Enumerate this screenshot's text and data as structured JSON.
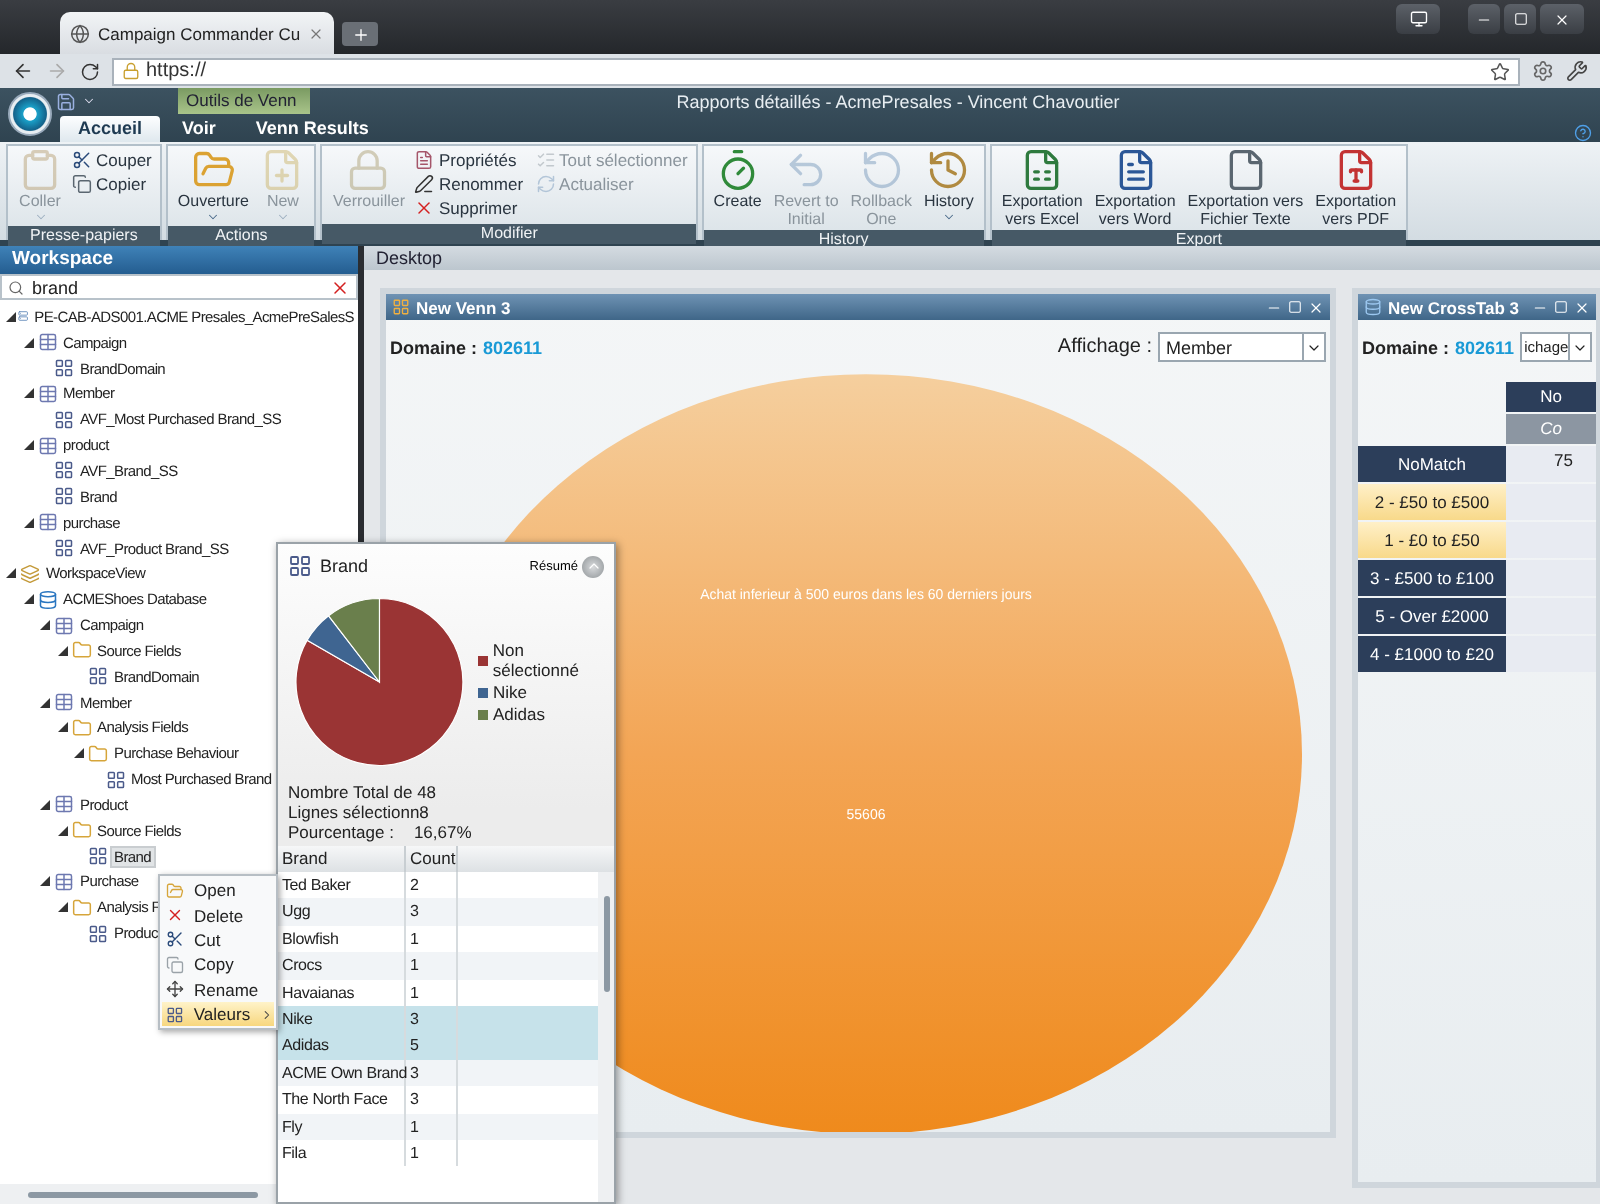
{
  "browser": {
    "tab_title": "Campaign Commander Cu",
    "address": "https://"
  },
  "app": {
    "context_tab": "Outils de Venn",
    "title": "Rapports détaillés - AcmePresales - Vincent Chavoutier"
  },
  "ribbon_tabs": [
    {
      "label": "Accueil",
      "selected": true
    },
    {
      "label": "Voir",
      "selected": false
    },
    {
      "label": "Venn Results",
      "selected": false
    }
  ],
  "ribbon_groups": [
    {
      "title": "Presse-papiers",
      "items": [
        {
          "label": "Coller",
          "kind": "large",
          "disabled": true,
          "dropdown": true
        },
        {
          "label": "Couper",
          "kind": "small",
          "disabled": false
        },
        {
          "label": "Copier",
          "kind": "small",
          "disabled": false
        }
      ]
    },
    {
      "title": "Actions",
      "items": [
        {
          "label": "Ouverture",
          "kind": "large",
          "disabled": false,
          "dropdown": true
        },
        {
          "label": "New",
          "kind": "large",
          "disabled": true,
          "dropdown": true
        }
      ]
    },
    {
      "title": "Modifier",
      "items": [
        {
          "label": "Verrouiller",
          "kind": "large",
          "disabled": true
        },
        {
          "label": "Propriétés",
          "kind": "small",
          "disabled": false
        },
        {
          "label": "Renommer",
          "kind": "small",
          "disabled": false
        },
        {
          "label": "Supprimer",
          "kind": "small",
          "disabled": false
        },
        {
          "label": "Tout sélectionner",
          "kind": "small",
          "disabled": true
        },
        {
          "label": "Actualiser",
          "kind": "small",
          "disabled": true
        }
      ]
    },
    {
      "title": "History",
      "items": [
        {
          "label": "Create",
          "kind": "large",
          "disabled": false
        },
        {
          "label": "Revert to\nInitial",
          "kind": "large",
          "disabled": true
        },
        {
          "label": "Rollback\nOne",
          "kind": "large",
          "disabled": true
        },
        {
          "label": "History",
          "kind": "large",
          "disabled": false,
          "dropdown": true
        }
      ]
    },
    {
      "title": "Export",
      "items": [
        {
          "label": "Exportation\nvers Excel",
          "kind": "large",
          "disabled": false
        },
        {
          "label": "Exportation\nvers Word",
          "kind": "large",
          "disabled": false
        },
        {
          "label": "Exportation vers\nFichier Texte",
          "kind": "large",
          "disabled": false
        },
        {
          "label": "Exportation\nvers PDF",
          "kind": "large",
          "disabled": false
        }
      ]
    }
  ],
  "workspace": {
    "title": "Workspace",
    "search": "brand",
    "tree": [
      {
        "label": "PE-CAB-ADS001.ACME Presales_AcmePreSalesS",
        "kind": "server",
        "expanded": true,
        "selected": false,
        "children": [
          {
            "label": "Campaign",
            "kind": "table",
            "expanded": true,
            "selected": false,
            "children": [
              {
                "label": "BrandDomain",
                "kind": "field",
                "selected": false
              }
            ]
          },
          {
            "label": "Member",
            "kind": "table",
            "expanded": true,
            "selected": false,
            "children": [
              {
                "label": "AVF_Most Purchased Brand_SS",
                "kind": "field",
                "selected": false
              }
            ]
          },
          {
            "label": "product",
            "kind": "table",
            "expanded": true,
            "selected": false,
            "children": [
              {
                "label": "AVF_Brand_SS",
                "kind": "field",
                "selected": false
              },
              {
                "label": "Brand",
                "kind": "field",
                "selected": false
              }
            ]
          },
          {
            "label": "purchase",
            "kind": "table",
            "expanded": true,
            "selected": false,
            "children": [
              {
                "label": "AVF_Product Brand_SS",
                "kind": "field",
                "selected": false
              }
            ]
          }
        ]
      },
      {
        "label": "WorkspaceView",
        "kind": "view",
        "expanded": true,
        "selected": false,
        "children": [
          {
            "label": "ACMEShoes Database",
            "kind": "database",
            "expanded": true,
            "selected": false,
            "children": [
              {
                "label": "Campaign",
                "kind": "table",
                "expanded": true,
                "selected": false,
                "children": [
                  {
                    "label": "Source Fields",
                    "kind": "folder",
                    "expanded": true,
                    "selected": false,
                    "children": [
                      {
                        "label": "BrandDomain",
                        "kind": "field",
                        "selected": false
                      }
                    ]
                  }
                ]
              },
              {
                "label": "Member",
                "kind": "table",
                "expanded": true,
                "selected": false,
                "children": [
                  {
                    "label": "Analysis Fields",
                    "kind": "folder",
                    "expanded": true,
                    "selected": false,
                    "children": [
                      {
                        "label": "Purchase Behaviour",
                        "kind": "folder",
                        "expanded": true,
                        "selected": false,
                        "children": [
                          {
                            "label": "Most Purchased Brand",
                            "kind": "field",
                            "selected": false
                          }
                        ]
                      }
                    ]
                  }
                ]
              },
              {
                "label": "Product",
                "kind": "table",
                "expanded": true,
                "selected": false,
                "children": [
                  {
                    "label": "Source Fields",
                    "kind": "folder",
                    "expanded": true,
                    "selected": false,
                    "children": [
                      {
                        "label": "Brand",
                        "kind": "field",
                        "selected": true
                      }
                    ]
                  }
                ]
              },
              {
                "label": "Purchase",
                "kind": "table",
                "expanded": true,
                "selected": false,
                "children": [
                  {
                    "label": "Analysis F",
                    "kind": "folder",
                    "expanded": true,
                    "selected": false,
                    "children": [
                      {
                        "label": "Produc",
                        "kind": "field",
                        "selected": false
                      }
                    ]
                  }
                ]
              }
            ]
          }
        ]
      }
    ]
  },
  "desktop_tab": "Desktop",
  "venn": {
    "title": "New Venn 3",
    "domain_label": "Domaine :",
    "domain": "802611",
    "display_label": "Affichage :",
    "display": "Member",
    "set_label": "Achat inferieur à 500 euros dans les 60 derniers jours",
    "count": "55606"
  },
  "crosstab": {
    "title": "New CrossTab 3",
    "domain_label": "Domaine :",
    "domain": "802611",
    "display": "ichage",
    "column_header": "No",
    "column_subheader": "Co",
    "rows": [
      {
        "label": "NoMatch",
        "value": "75",
        "selected": false
      },
      {
        "label": "2 - £50 to £500",
        "selected": true
      },
      {
        "label": "1 - £0 to £50",
        "selected": true
      },
      {
        "label": "3 - £500 to £100",
        "selected": false
      },
      {
        "label": "5 - Over £2000",
        "selected": false
      },
      {
        "label": "4 - £1000 to £20",
        "selected": false
      }
    ]
  },
  "popup": {
    "title": "Brand",
    "summary_button": "Résumé",
    "chart_data": {
      "type": "pie",
      "categories": [
        "Non sélectionné",
        "Nike",
        "Adidas"
      ],
      "values": [
        83.33,
        6.25,
        10.42
      ]
    },
    "stats": [
      {
        "label": "Nombre Total de 48"
      },
      {
        "label": "Lignes sélectionn8"
      },
      {
        "label": "Pourcentage :",
        "value": "16,67%"
      }
    ],
    "columns": [
      "Brand",
      "Count"
    ],
    "rows": [
      {
        "brand": "Ted Baker",
        "count": "2",
        "selected": false
      },
      {
        "brand": "Ugg",
        "count": "3",
        "selected": false
      },
      {
        "brand": "Blowfish",
        "count": "1",
        "selected": false
      },
      {
        "brand": "Crocs",
        "count": "1",
        "selected": false
      },
      {
        "brand": "Havaianas",
        "count": "1",
        "selected": false
      },
      {
        "brand": "Nike",
        "count": "3",
        "selected": true
      },
      {
        "brand": "Adidas",
        "count": "5",
        "selected": true
      },
      {
        "brand": "ACME Own Brand",
        "count": "3",
        "selected": false
      },
      {
        "brand": "The North Face",
        "count": "3",
        "selected": false
      },
      {
        "brand": "Fly",
        "count": "1",
        "selected": false
      },
      {
        "brand": "Fila",
        "count": "1",
        "selected": false
      }
    ]
  },
  "context_menu": [
    {
      "label": "Open",
      "kind": "open",
      "selected": false
    },
    {
      "label": "Delete",
      "kind": "delete",
      "selected": false
    },
    {
      "label": "Cut",
      "kind": "cut",
      "selected": false
    },
    {
      "label": "Copy",
      "kind": "copy",
      "selected": false
    },
    {
      "label": "Rename",
      "kind": "rename",
      "selected": false
    },
    {
      "label": "Valeurs",
      "kind": "values",
      "selected": true,
      "submenu": true
    }
  ]
}
